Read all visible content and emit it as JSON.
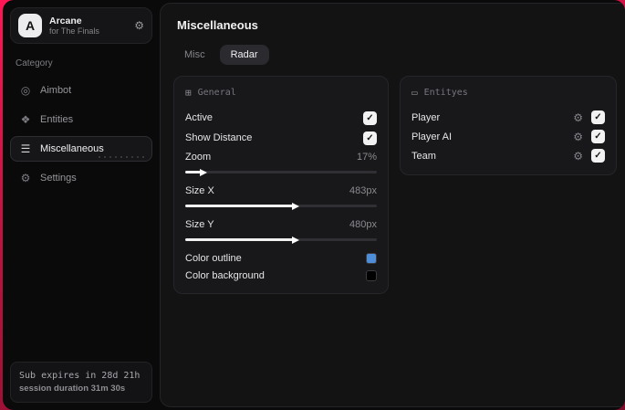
{
  "app": {
    "name": "Arcane",
    "subtitle": "for The Finals",
    "logo_letter": "A"
  },
  "sidebar": {
    "category_label": "Category",
    "items": [
      {
        "label": "Aimbot",
        "icon": "◎",
        "selected": false
      },
      {
        "label": "Entities",
        "icon": "❖",
        "selected": false
      },
      {
        "label": "Miscellaneous",
        "icon": "☰",
        "selected": true
      },
      {
        "label": "Settings",
        "icon": "⚙",
        "selected": false
      }
    ],
    "footer": {
      "line1": "Sub expires in 28d 21h",
      "line2": "session duration 31m 30s"
    }
  },
  "main": {
    "title": "Miscellaneous",
    "tabs": [
      {
        "label": "Misc",
        "active": false
      },
      {
        "label": "Radar",
        "active": true
      }
    ]
  },
  "general_panel": {
    "title": "General",
    "icon": "⊞",
    "toggles": [
      {
        "label": "Active",
        "checked": true
      },
      {
        "label": "Show Distance",
        "checked": true
      }
    ],
    "sliders": [
      {
        "label": "Zoom",
        "value": "17%",
        "fill": "8%"
      },
      {
        "label": "Size X",
        "value": "483px",
        "fill": "56%"
      },
      {
        "label": "Size Y",
        "value": "480px",
        "fill": "56%"
      }
    ],
    "colors": [
      {
        "label": "Color outline",
        "swatch": "#4e8ed9"
      },
      {
        "label": "Color background",
        "swatch": "#000000"
      }
    ]
  },
  "entities_panel": {
    "title": "Entityes",
    "icon": "▭",
    "rows": [
      {
        "label": "Player",
        "checked": true
      },
      {
        "label": "Player AI",
        "checked": true
      },
      {
        "label": "Team",
        "checked": true
      }
    ]
  },
  "glyphs": {
    "check": "✓",
    "gear": "⚙"
  },
  "colors": {
    "accent_background": "#c11340",
    "outline_swatch": "#4e8ed9",
    "background_swatch": "#000000"
  }
}
